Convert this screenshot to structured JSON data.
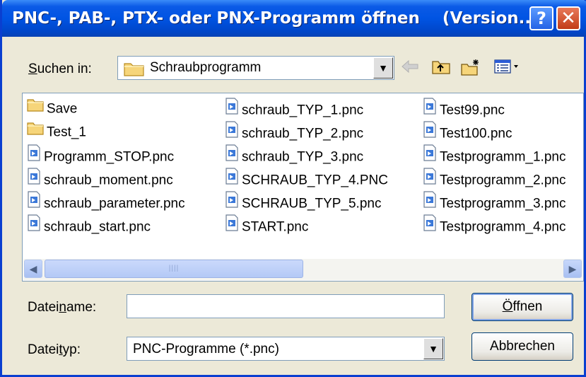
{
  "window": {
    "title": "PNC-, PAB-, PTX- oder PNX-Programm öffnen    (Version...",
    "help_label": "?",
    "close_label": "✕"
  },
  "toolbar": {
    "lookin_label_prefix": "S",
    "lookin_label_rest": "uchen in:",
    "current_folder": "Schraubprogramm",
    "icons": [
      "folder-icon",
      "back-arrow-icon",
      "up-folder-icon",
      "new-folder-icon",
      "view-menu-icon"
    ]
  },
  "files": {
    "column1": [
      {
        "name": "Save",
        "type": "folder"
      },
      {
        "name": "Test_1",
        "type": "folder"
      },
      {
        "name": "Programm_STOP.pnc",
        "type": "file"
      },
      {
        "name": "schraub_moment.pnc",
        "type": "file"
      },
      {
        "name": "schraub_parameter.pnc",
        "type": "file"
      },
      {
        "name": "schraub_start.pnc",
        "type": "file"
      }
    ],
    "column2": [
      {
        "name": "schraub_TYP_1.pnc",
        "type": "file"
      },
      {
        "name": "schraub_TYP_2.pnc",
        "type": "file"
      },
      {
        "name": "schraub_TYP_3.pnc",
        "type": "file"
      },
      {
        "name": "SCHRAUB_TYP_4.PNC",
        "type": "file"
      },
      {
        "name": "SCHRAUB_TYP_5.pnc",
        "type": "file"
      },
      {
        "name": "START.pnc",
        "type": "file"
      }
    ],
    "column3": [
      {
        "name": "Test99.pnc",
        "type": "file"
      },
      {
        "name": "Test100.pnc",
        "type": "file"
      },
      {
        "name": "Testprogramm_1.pnc",
        "type": "file"
      },
      {
        "name": "Testprogramm_2.pnc",
        "type": "file"
      },
      {
        "name": "Testprogramm_3.pnc",
        "type": "file"
      },
      {
        "name": "Testprogramm_4.pnc",
        "type": "file"
      }
    ]
  },
  "filename": {
    "label_prefix": "Datei",
    "label_underlined": "n",
    "label_rest": "ame:",
    "value": ""
  },
  "filetype": {
    "label_prefix": "Datei",
    "label_underlined": "t",
    "label_rest": "yp:",
    "value": "PNC-Programme (*.pnc)"
  },
  "buttons": {
    "open_underlined": "Ö",
    "open_rest": "ffnen",
    "cancel_label": "Abbrechen"
  },
  "colors": {
    "titlebar": "#0054e3",
    "dialog_bg": "#ece9d8",
    "close_button": "#c23c17"
  }
}
